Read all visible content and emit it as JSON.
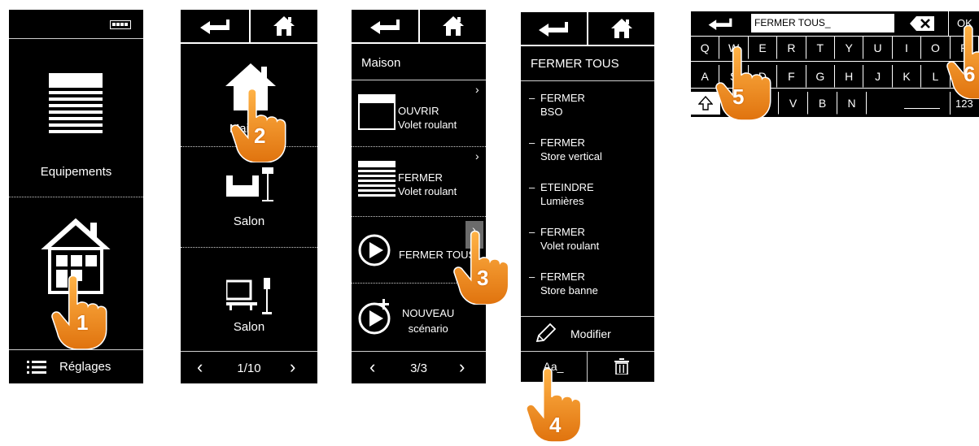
{
  "screen1": {
    "equipments_label": "Equipements",
    "settings_label": "Réglages",
    "step": "1"
  },
  "screen2": {
    "items": [
      "Maison",
      "Salon",
      "Salon"
    ],
    "pager": "1/10",
    "step": "2"
  },
  "screen3": {
    "title": "Maison",
    "scenarios": [
      {
        "line1": "OUVRIR",
        "line2": "Volet roulant"
      },
      {
        "line1": "FERMER",
        "line2": "Volet roulant"
      },
      {
        "line1": "FERMER TOUS",
        "line2": ""
      },
      {
        "line1": "NOUVEAU",
        "line2": "scénario"
      }
    ],
    "pager": "3/3",
    "step": "3"
  },
  "screen4": {
    "title": "FERMER TOUS",
    "actions": [
      {
        "action": "FERMER",
        "device": "BSO"
      },
      {
        "action": "FERMER",
        "device": "Store vertical"
      },
      {
        "action": "ETEINDRE",
        "device": "Lumières"
      },
      {
        "action": "FERMER",
        "device": "Volet roulant"
      },
      {
        "action": "FERMER",
        "device": "Store banne"
      }
    ],
    "modify_label": "Modifier",
    "rename_label": "Aa_",
    "step": "4"
  },
  "screen5": {
    "input_value": "FERMER TOUS_",
    "ok_label": "OK",
    "row1": [
      "Q",
      "W",
      "E",
      "R",
      "T",
      "Y",
      "U",
      "I",
      "O",
      "P"
    ],
    "row2": [
      "A",
      "S",
      "D",
      "F",
      "G",
      "H",
      "J",
      "K",
      "L",
      "M"
    ],
    "row3": [
      "X",
      "C",
      "V",
      "B",
      "N"
    ],
    "numeric_label": "123",
    "step5": "5",
    "step6": "6"
  },
  "colors": {
    "background": "#000000",
    "text": "#ffffff",
    "accent_hand": "#f08a1c",
    "separator": "#cfcfcf"
  }
}
